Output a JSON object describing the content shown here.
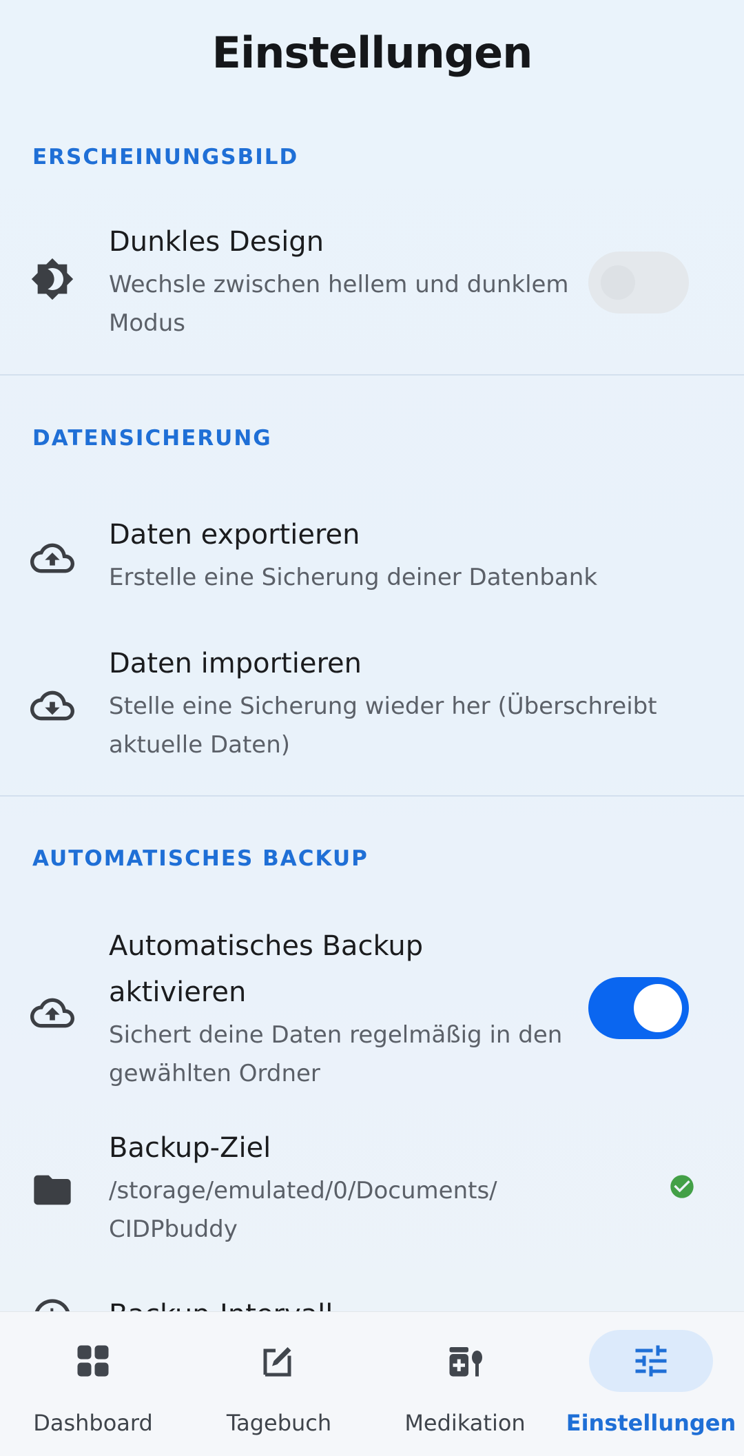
{
  "page_title": "Einstellungen",
  "sections": {
    "appearance": {
      "header": "ERSCHEINUNGSBILD",
      "dark_mode": {
        "label": "Dunkles Design",
        "sub": "Wechsle zwischen hellem und dunklem Modus",
        "enabled": false,
        "icon": "brightness-icon"
      }
    },
    "backup": {
      "header": "DATENSICHERUNG",
      "export": {
        "label": "Daten exportieren",
        "sub": "Erstelle eine Sicherung deiner Datenbank",
        "icon": "cloud-upload-icon"
      },
      "import": {
        "label": "Daten importieren",
        "sub": "Stelle eine Sicherung wieder her (Überschreibt aktuelle Daten)",
        "icon": "cloud-download-icon"
      }
    },
    "auto_backup": {
      "header": "AUTOMATISCHES BACKUP",
      "enable": {
        "label": "Automatisches Backup aktivieren",
        "sub": "Sichert deine Daten regelmäßig in den gewählten Ordner",
        "enabled": true,
        "icon": "cloud-upload-icon"
      },
      "target": {
        "label": "Backup-Ziel",
        "path": "/storage/emulated/0/Documents/ CIDPbuddy",
        "status": "ok",
        "icon": "folder-icon"
      },
      "partial_row": {
        "label": "Backup-Intervall",
        "icon": "clock-icon"
      }
    }
  },
  "nav": {
    "items": [
      {
        "label": "Dashboard",
        "icon": "dashboard-icon",
        "active": false
      },
      {
        "label": "Tagebuch",
        "icon": "diary-edit-icon",
        "active": false
      },
      {
        "label": "Medikation",
        "icon": "medication-icon",
        "active": false
      },
      {
        "label": "Einstellungen",
        "icon": "settings-sliders-icon",
        "active": true
      }
    ]
  },
  "colors": {
    "accent": "#1f6fd6",
    "toggle_on": "#0a66f0",
    "success": "#43a047",
    "background": "#eaf3fb"
  }
}
